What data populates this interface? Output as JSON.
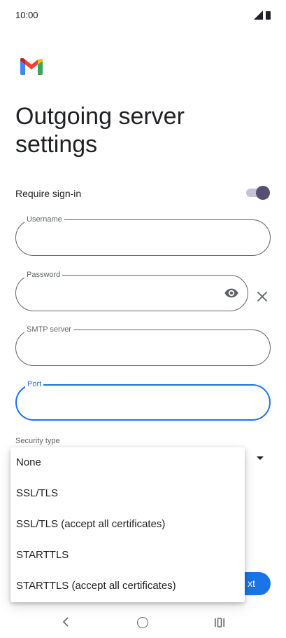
{
  "status_bar": {
    "time": "10:00"
  },
  "page": {
    "title": "Outgoing server settings"
  },
  "require_signin": {
    "label": "Require sign-in",
    "enabled": true
  },
  "fields": {
    "username": {
      "label": "Username",
      "value": ""
    },
    "password": {
      "label": "Password",
      "value": ""
    },
    "smtp_server": {
      "label": "SMTP server",
      "value": ""
    },
    "port": {
      "label": "Port",
      "value": ""
    }
  },
  "security": {
    "label": "Security type"
  },
  "dropdown": {
    "options": [
      "None",
      "SSL/TLS",
      "SSL/TLS (accept all certificates)",
      "STARTTLS",
      "STARTTLS (accept all certificates)"
    ]
  },
  "next_button": {
    "label": "xt"
  },
  "icons": {
    "logo": "gmail-logo",
    "signal": "signal-icon",
    "battery": "battery-icon",
    "eye": "eye-icon",
    "clear": "close-icon",
    "dropdown": "dropdown-arrow-icon",
    "back": "back-icon",
    "home": "home-icon",
    "recents": "recents-icon"
  },
  "colors": {
    "accent": "#1a73e8",
    "toggle_thumb": "#574f72",
    "toggle_track": "#c6c1d4",
    "outline": "#5f6368"
  }
}
